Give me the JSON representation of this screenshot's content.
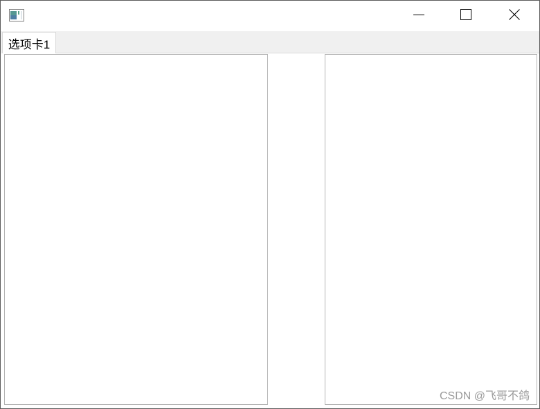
{
  "window": {
    "icon": "app-window-icon",
    "controls": {
      "minimize_icon": "minimize-icon",
      "maximize_icon": "maximize-icon",
      "close_icon": "close-icon"
    }
  },
  "tabs": [
    {
      "label": "选项卡1",
      "selected": true
    }
  ],
  "panes": {
    "left": "",
    "right": ""
  },
  "watermark": "CSDN @飞哥不鸽",
  "colors": {
    "titlebar_bg": "#ffffff",
    "tabbar_bg": "#f0f0f0",
    "pane_border": "#b4b4b4",
    "window_border": "#5a5a5a",
    "watermark": "#9a9a9a"
  }
}
